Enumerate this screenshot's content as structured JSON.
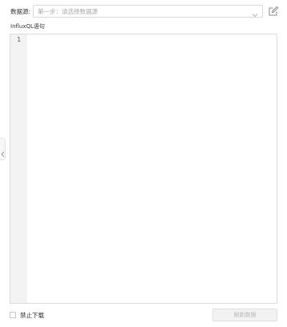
{
  "datasource": {
    "label": "数据源:",
    "placeholder": "第一步：请选择数据源",
    "dropdown_icon": "chevron-down-icon",
    "edit_icon": "edit-icon"
  },
  "query": {
    "label": "InfluxQL语句",
    "line_numbers": [
      "1"
    ],
    "content": ""
  },
  "sidebar_toggle": {
    "icon": "chevron-left-icon"
  },
  "footer": {
    "disable_download_label": "禁止下载",
    "disable_download_checked": false,
    "refresh_button_label": "刷新数据"
  }
}
